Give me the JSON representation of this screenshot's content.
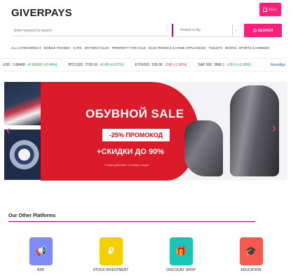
{
  "header": {
    "logo": "GIVERPAYS",
    "sell_label": "SELL",
    "keyword_placeholder": "Enter keyword to search",
    "location_placeholder": "Search a city",
    "location_toggle": "⌄",
    "search_label": "SEARCH"
  },
  "categories": [
    "ALL CATEGORIES ▾",
    "MOBILE PHONES",
    "CARS",
    "MOTORCYCLES",
    "PROPERTY FOR SALE",
    "ELECTRONICS & HOME APPLIANCES",
    "TABLETS",
    "BOOKS, SPORTS & HOBBIES"
  ],
  "ticker": [
    {
      "symbol": "USD",
      "price": "1.08468",
      "change": "+0.00050 (+0.04%)",
      "direction": "up"
    },
    {
      "symbol": "BTCUSD",
      "price": "7703.16",
      "change": "+5.40 (+0.07%)",
      "direction": "up"
    },
    {
      "symbol": "ETHUSD",
      "price": "195.00",
      "change": "-2.06 (-1.50%)",
      "direction": "down"
    },
    {
      "symbol": "S&P 500",
      "price": "2866.1",
      "change": "+28.5 (+1.00%)",
      "direction": "up"
    }
  ],
  "ticker_brand": "NewsApp",
  "banner": {
    "title": "ОБУВНОЙ SALE",
    "promo": "-25% ПРОМОКОД",
    "discount": "+СКИДКИ ДО 90%",
    "fine_print": "* Скидки действуют на товары в акции",
    "prev_arrow": "‹",
    "next_arrow": "›"
  },
  "platforms_title": "Our Other Platforms",
  "platforms": [
    {
      "label": "B2B",
      "icon": "megaphone-icon",
      "glyph": "📢",
      "color": "#7b8cf6"
    },
    {
      "label": "STOCK INVESTMENT",
      "icon": "ruble-icon",
      "glyph": "₽",
      "color": "#f5d000"
    },
    {
      "label": "DISCOUNT SHOP",
      "icon": "gift-icon",
      "glyph": "🎁",
      "color": "#18c6b7"
    },
    {
      "label": "EDUCATION",
      "icon": "graduation-cap-icon",
      "glyph": "🎓",
      "color": "#f55a4f"
    }
  ],
  "colors": {
    "brand": "#ff1f7a",
    "banner": "#dc1b2a",
    "positive": "#16a34a",
    "negative": "#e11d48"
  }
}
